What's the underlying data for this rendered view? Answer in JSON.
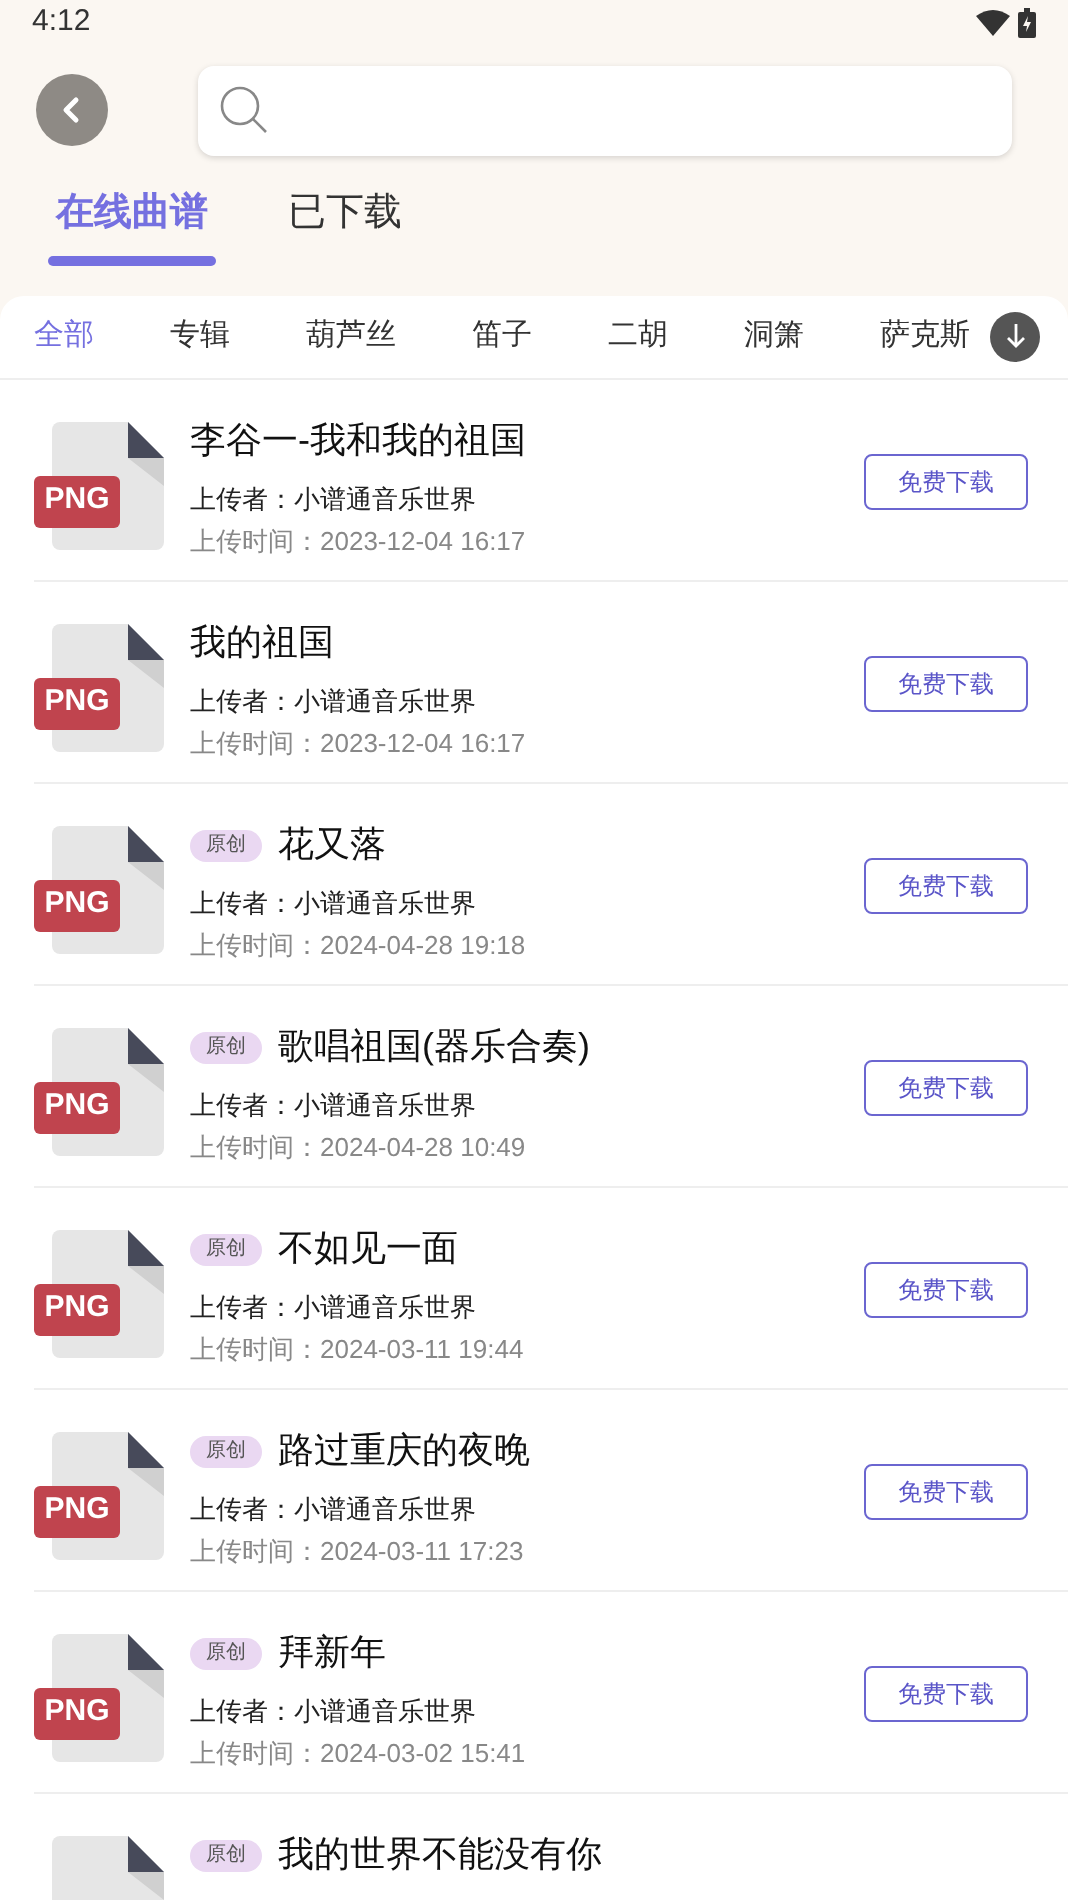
{
  "status_bar": {
    "time": "4:12"
  },
  "tabs": [
    {
      "label": "在线曲谱",
      "selected": true
    },
    {
      "label": "已下载",
      "selected": false
    }
  ],
  "categories": [
    {
      "label": "全部",
      "selected": true
    },
    {
      "label": "专辑",
      "selected": false
    },
    {
      "label": "葫芦丝",
      "selected": false
    },
    {
      "label": "笛子",
      "selected": false
    },
    {
      "label": "二胡",
      "selected": false
    },
    {
      "label": "洞箫",
      "selected": false
    },
    {
      "label": "萨克斯",
      "selected": false
    }
  ],
  "items": [
    {
      "file_type": "PNG",
      "title": "李谷一-我和我的祖国",
      "uploader": "上传者：小谱通音乐世界",
      "time": "上传时间：2023-12-04 16:17",
      "button": "免费下载"
    },
    {
      "file_type": "PNG",
      "title": "我的祖国",
      "uploader": "上传者：小谱通音乐世界",
      "time": "上传时间：2023-12-04 16:17",
      "button": "免费下载"
    },
    {
      "file_type": "PNG",
      "tag": "原创",
      "title": "花又落",
      "uploader": "上传者：小谱通音乐世界",
      "time": "上传时间：2024-04-28 19:18",
      "button": "免费下载"
    },
    {
      "file_type": "PNG",
      "tag": "原创",
      "title": "歌唱祖国(器乐合奏)",
      "uploader": "上传者：小谱通音乐世界",
      "time": "上传时间：2024-04-28 10:49",
      "button": "免费下载"
    },
    {
      "file_type": "PNG",
      "tag": "原创",
      "title": "不如见一面",
      "uploader": "上传者：小谱通音乐世界",
      "time": "上传时间：2024-03-11 19:44",
      "button": "免费下载"
    },
    {
      "file_type": "PNG",
      "tag": "原创",
      "title": "路过重庆的夜晚",
      "uploader": "上传者：小谱通音乐世界",
      "time": "上传时间：2024-03-11 17:23",
      "button": "免费下载"
    },
    {
      "file_type": "PNG",
      "tag": "原创",
      "title": "拜新年",
      "uploader": "上传者：小谱通音乐世界",
      "time": "上传时间：2024-03-02 15:41",
      "button": "免费下载"
    },
    {
      "tag": "原创",
      "title": "我的世界不能没有你"
    }
  ]
}
